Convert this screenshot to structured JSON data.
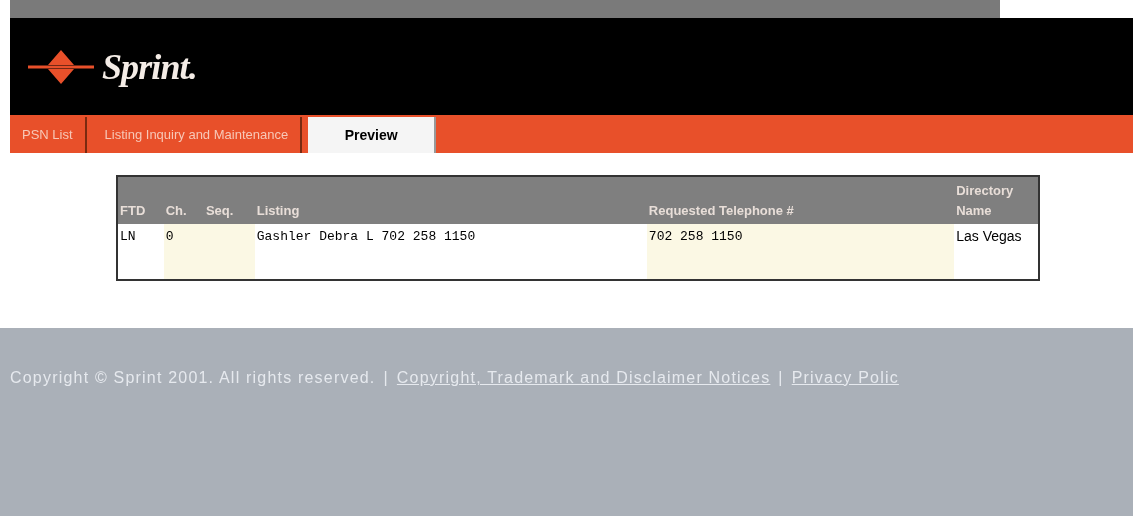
{
  "logo": {
    "text": "Sprint."
  },
  "tabs": [
    {
      "label": "PSN List",
      "selected": false
    },
    {
      "label": "Listing Inquiry and Maintenance",
      "selected": false
    },
    {
      "label": "Preview",
      "selected": true
    }
  ],
  "table": {
    "columns": [
      {
        "label": "FTD",
        "highlighted": false
      },
      {
        "label": "Ch.",
        "highlighted": true
      },
      {
        "label": "Seq.",
        "highlighted": true
      },
      {
        "label": "Listing",
        "highlighted": false
      },
      {
        "label": "Requested Telephone #",
        "highlighted": true
      },
      {
        "label": "Directory Name",
        "highlighted": false
      }
    ],
    "rows": [
      {
        "ftd": "LN",
        "ch": "0",
        "listing": "Gashler Debra L 702 258 1150",
        "telephone": "702 258 1150",
        "directory": "Las Vegas"
      }
    ]
  },
  "footer": {
    "items": [
      {
        "kind": "text",
        "text": "Copyright © Sprint 2001. All rights reserved."
      },
      {
        "kind": "separator",
        "text": "|"
      },
      {
        "kind": "link",
        "text": "Copyright, Trademark and Disclaimer Notices"
      },
      {
        "kind": "separator",
        "text": "|"
      },
      {
        "kind": "link",
        "text": "Privacy Polic"
      }
    ]
  }
}
